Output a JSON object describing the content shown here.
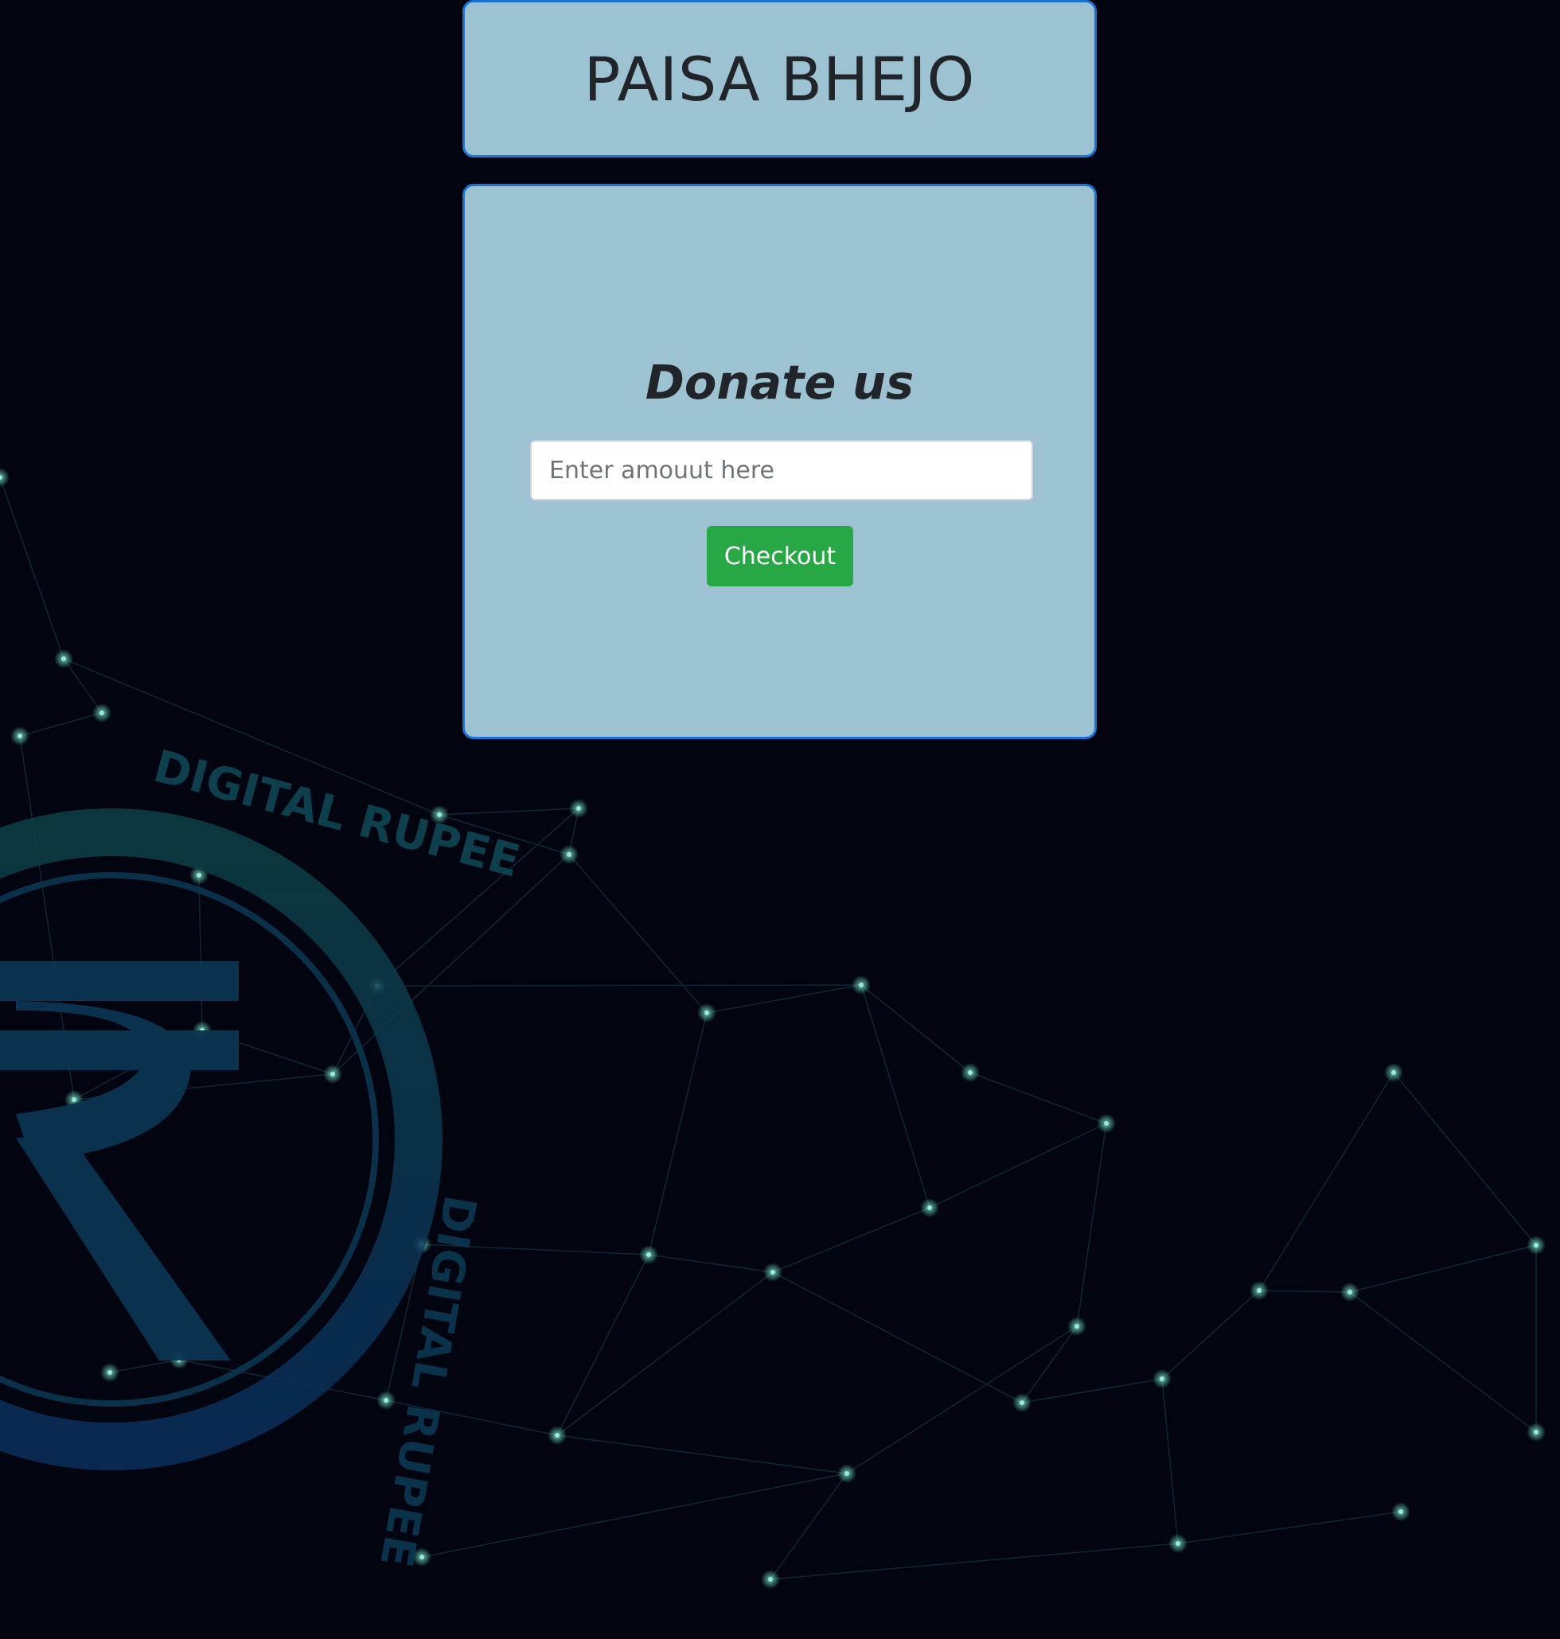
{
  "header": {
    "title": "PAISA BHEJO"
  },
  "donate": {
    "heading": "Donate us",
    "amount_placeholder": "Enter amouut here",
    "amount_value": "",
    "checkout_label": "Checkout"
  },
  "background": {
    "emblem_text": "DIGITAL RUPEE",
    "emblem_glyph": "₹",
    "icon": "digital-rupee-emblem-icon"
  },
  "colors": {
    "page_bg": "#02050f",
    "card_bg": "#9dc3d2",
    "card_border": "#1a73d6",
    "checkout_bg": "#28a745",
    "text": "#212529"
  }
}
